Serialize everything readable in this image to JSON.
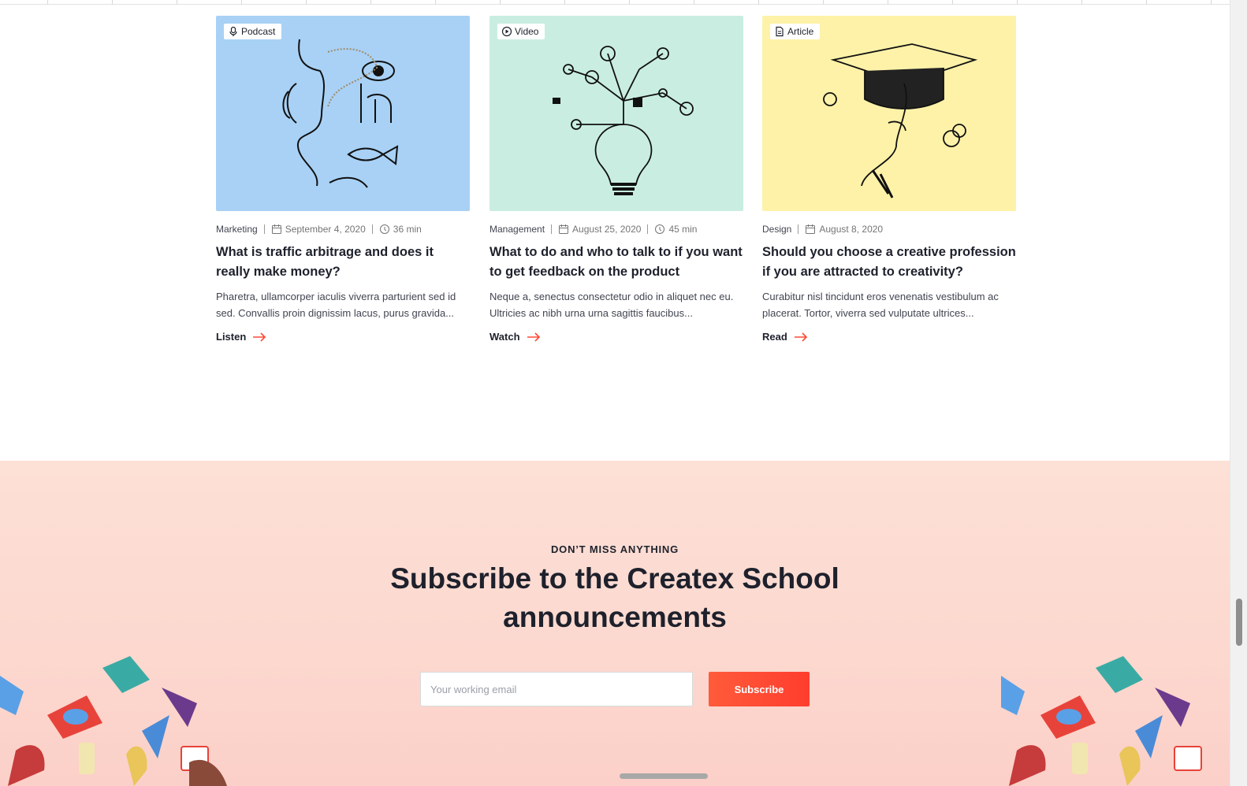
{
  "cards": [
    {
      "type": "Podcast",
      "type_icon": "microphone-icon",
      "bg": "#a8d1f5",
      "category": "Marketing",
      "date": "September 4, 2020",
      "duration": "36 min",
      "title": "What is traffic arbitrage and does it really make money?",
      "excerpt": "Pharetra, ullamcorper iaculis viverra parturient sed id sed. Convallis proin dignissim lacus, purus gravida...",
      "cta": "Listen"
    },
    {
      "type": "Video",
      "type_icon": "play-icon",
      "bg": "#c9eee1",
      "category": "Management",
      "date": "August 25, 2020",
      "duration": "45 min",
      "title": "What to do and who to talk to if you want to get feedback on the product",
      "excerpt": "Neque a, senectus consectetur odio in aliquet nec eu. Ultricies ac nibh urna urna sagittis faucibus...",
      "cta": "Watch"
    },
    {
      "type": "Article",
      "type_icon": "file-icon",
      "bg": "#fdf2a8",
      "category": "Design",
      "date": "August 8, 2020",
      "title": "Should you choose a creative profession if you are attracted to creativity?",
      "excerpt": "Curabitur nisl tincidunt eros venenatis vestibulum ac placerat. Tortor, viverra sed vulputate ultrices...",
      "cta": "Read"
    }
  ],
  "subscribe": {
    "eyebrow": "DON’T MISS ANYTHING",
    "heading": "Subscribe to the Createx School announcements",
    "email_placeholder": "Your working email",
    "button": "Subscribe"
  },
  "colors": {
    "accent": "#ff4a35",
    "text_dark": "#1e212c",
    "subscribe_bg": "#fcd8cf"
  }
}
